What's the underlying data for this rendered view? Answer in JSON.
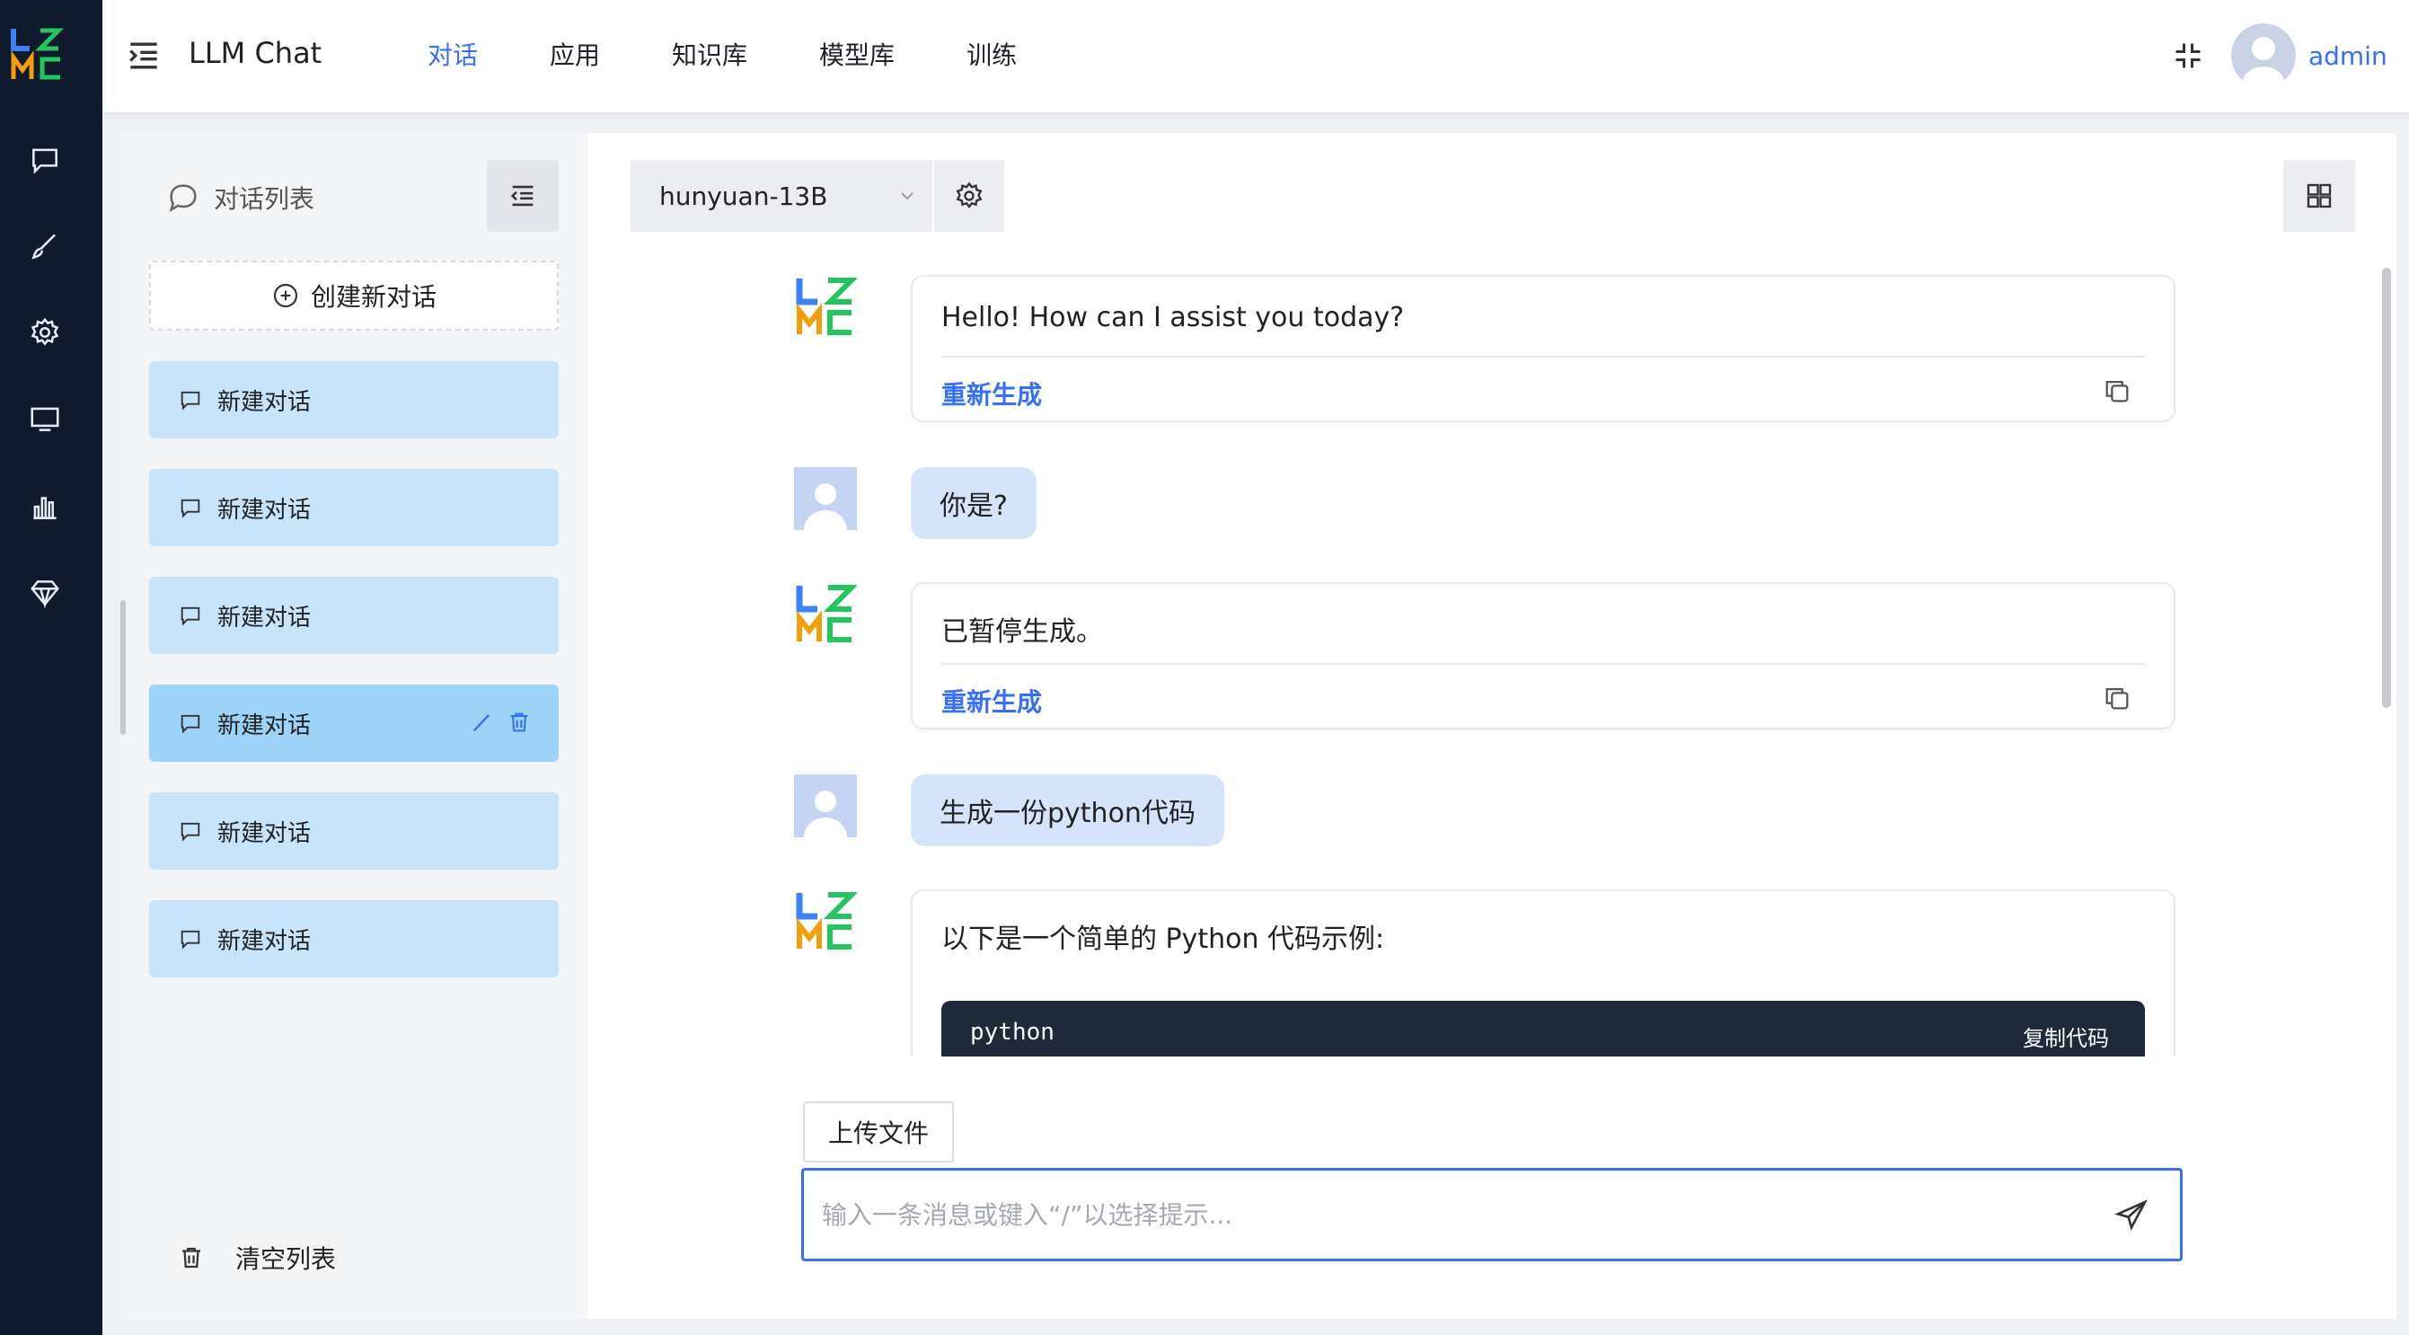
{
  "app": {
    "title": "LLM Chat",
    "brand_color": "#3370ff",
    "rail_color": "#0f1b2d"
  },
  "nav": {
    "items": [
      {
        "label": "对话",
        "active": true
      },
      {
        "label": "应用",
        "active": false
      },
      {
        "label": "知识库",
        "active": false
      },
      {
        "label": "模型库",
        "active": false
      },
      {
        "label": "训练",
        "active": false
      }
    ]
  },
  "rail": {
    "icons": [
      "chat-icon",
      "brush-icon",
      "gear-icon",
      "monitor-icon",
      "bar-chart-icon",
      "diamond-icon"
    ]
  },
  "user": {
    "name": "admin"
  },
  "sidebar": {
    "title": "对话列表",
    "new_chat_label": "创建新对话",
    "conversations": [
      {
        "label": "新建对话"
      },
      {
        "label": "新建对话"
      },
      {
        "label": "新建对话"
      },
      {
        "label": "新建对话",
        "active": true
      },
      {
        "label": "新建对话"
      },
      {
        "label": "新建对话"
      }
    ],
    "clear_label": "清空列表"
  },
  "toolbar": {
    "model": "hunyuan-13B"
  },
  "messages": [
    {
      "role": "assistant",
      "text": "Hello! How can I assist you today?",
      "regen": "重新生成"
    },
    {
      "role": "user",
      "text": "你是?"
    },
    {
      "role": "assistant",
      "text": "已暂停生成。",
      "regen": "重新生成"
    },
    {
      "role": "user",
      "text": "生成一份python代码"
    },
    {
      "role": "assistant",
      "text": "以下是一个简单的 Python 代码示例:",
      "code_lang": "python",
      "copy_code": "复制代码"
    }
  ],
  "composer": {
    "upload_label": "上传文件",
    "placeholder": "输入一条消息或键入“/”以选择提示..."
  }
}
